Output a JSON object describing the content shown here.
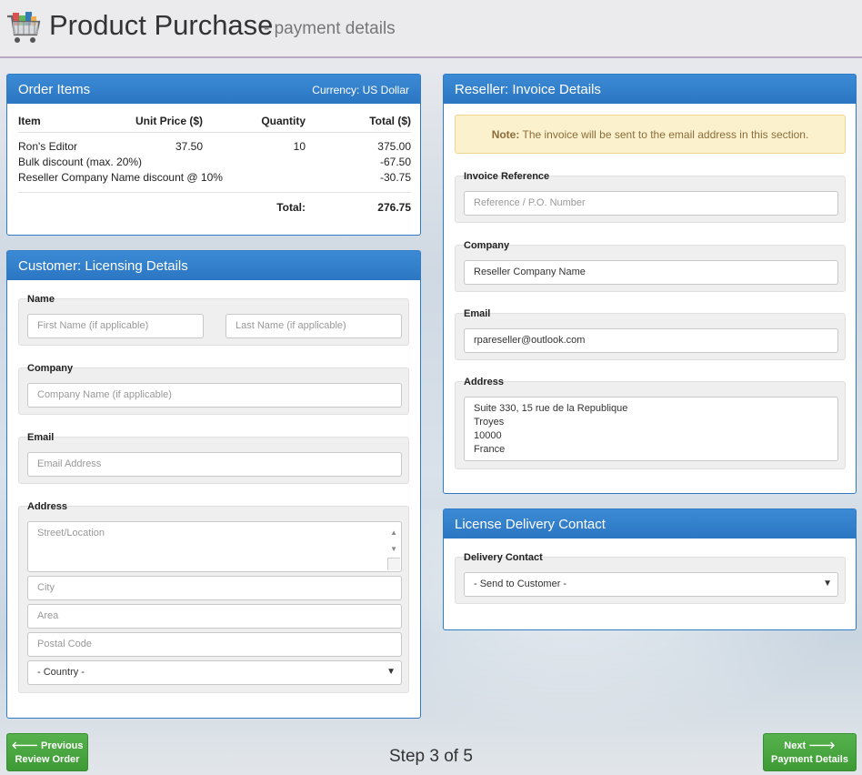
{
  "header": {
    "title": "Product Purchase",
    "subtitle": "- payment details"
  },
  "order_items": {
    "heading": "Order Items",
    "currency": "Currency: US Dollar",
    "columns": [
      "Item",
      "Unit Price ($)",
      "Quantity",
      "Total ($)"
    ],
    "rows": [
      {
        "item": "Ron's Editor",
        "unit": "37.50",
        "qty": "10",
        "total": "375.00"
      },
      {
        "item": "Bulk discount (max. 20%)",
        "unit": "",
        "qty": "",
        "total": "-67.50"
      },
      {
        "item": "Reseller Company Name discount @ 10%",
        "unit": "",
        "qty": "",
        "total": "-30.75"
      }
    ],
    "total_label": "Total:",
    "total_value": "276.75"
  },
  "customer": {
    "heading": "Customer: Licensing Details",
    "name_legend": "Name",
    "first_name_placeholder": "First Name (if applicable)",
    "last_name_placeholder": "Last Name (if applicable)",
    "company_legend": "Company",
    "company_placeholder": "Company Name (if applicable)",
    "email_legend": "Email",
    "email_placeholder": "Email Address",
    "address_legend": "Address",
    "street_placeholder": "Street/Location",
    "city_placeholder": "City",
    "area_placeholder": "Area",
    "postal_placeholder": "Postal Code",
    "country_value": "- Country -"
  },
  "reseller": {
    "heading": "Reseller: Invoice Details",
    "note_label": "Note:",
    "note_text": "The invoice will be sent to the email address in this section.",
    "invoice_ref_legend": "Invoice Reference",
    "invoice_ref_placeholder": "Reference / P.O. Number",
    "company_legend": "Company",
    "company_value": "Reseller Company Name",
    "email_legend": "Email",
    "email_value": "rpareseller@outlook.com",
    "address_legend": "Address",
    "address_lines": [
      "Suite 330, 15 rue de la Republique",
      "Troyes",
      "10000",
      "France"
    ]
  },
  "delivery": {
    "heading": "License Delivery Contact",
    "legend": "Delivery Contact",
    "value": "- Send to Customer -"
  },
  "footer": {
    "prev_line1": "Previous",
    "prev_line2": "Review Order",
    "step_text": "Step 3 of 5",
    "next_line1": "Next",
    "next_line2": "Payment Details"
  },
  "colors": {
    "panel_header": "#2f7bc4",
    "button_green": "#45a33c",
    "note_bg": "#fcf1cd"
  },
  "icons": [
    "shopping-cart-icon",
    "arrow-left-icon",
    "arrow-right-icon",
    "chevron-down-icon"
  ]
}
